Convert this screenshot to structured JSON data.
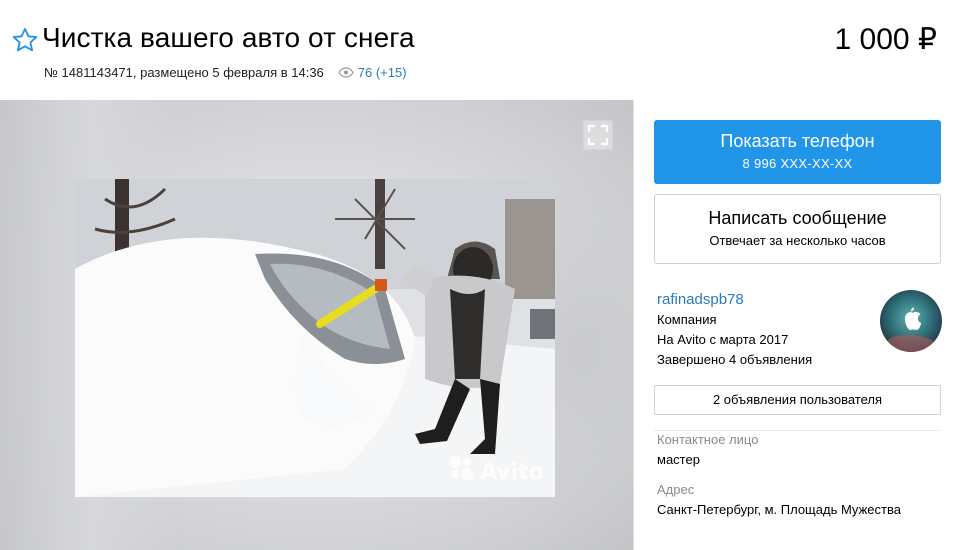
{
  "listing": {
    "title": "Чистка вашего авто от снега",
    "price": "1 000 ₽",
    "meta_text": "№ 1481143471, размещено 5 февраля в 14:36",
    "views": "76 (+15)"
  },
  "gallery": {
    "watermark": "Avito"
  },
  "sidebar": {
    "phone_button": {
      "label": "Показать телефон",
      "number": "8 996 XXX-XX-XX"
    },
    "message_button": {
      "label": "Написать сообщение",
      "subtitle": "Отвечает за несколько часов"
    },
    "seller": {
      "name": "rafinadspb78",
      "type": "Компания",
      "since": "На Avito с марта 2017",
      "completed": "Завершено 4 объявления"
    },
    "user_ads_button": "2 объявления пользователя",
    "contact_label": "Контактное лицо",
    "contact_value": "мастер",
    "address_label": "Адрес",
    "address_value": "Санкт-Петербург, м. Площадь Мужества"
  },
  "colors": {
    "accent": "#2196e8",
    "link": "#2c7ab7",
    "muted": "#8a8a8a"
  },
  "icons": [
    "star-outline-icon",
    "eye-icon",
    "fullscreen-icon",
    "apple-icon",
    "avito-logo-icon"
  ]
}
